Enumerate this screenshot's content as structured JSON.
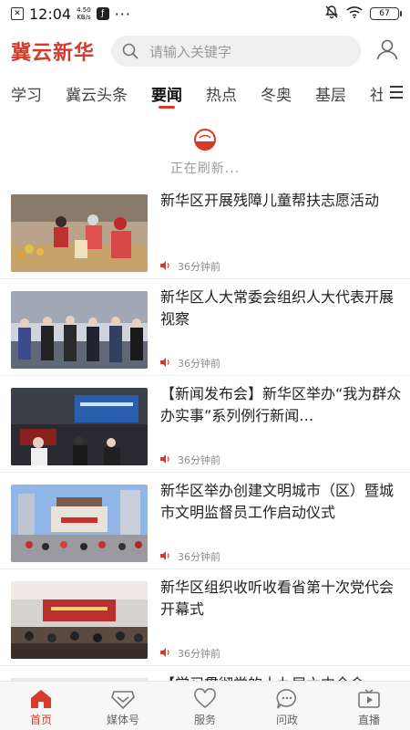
{
  "status_bar": {
    "time": "12:04",
    "speed_value": "4.50",
    "speed_unit": "KB/s",
    "more": "···",
    "battery": "67"
  },
  "header": {
    "logo": "冀云新华",
    "search_placeholder": "请输入关键字"
  },
  "tabs": [
    {
      "label": "学习",
      "active": false
    },
    {
      "label": "冀云头条",
      "active": false
    },
    {
      "label": "要闻",
      "active": true
    },
    {
      "label": "热点",
      "active": false
    },
    {
      "label": "冬奥",
      "active": false
    },
    {
      "label": "基层",
      "active": false
    },
    {
      "label": "社",
      "active": false
    }
  ],
  "refresh": {
    "text": "正在刷新..."
  },
  "news": [
    {
      "title": "新华区开展残障儿童帮扶志愿活动",
      "time": "36分钟前"
    },
    {
      "title": "新华区人大常委会组织人大代表开展视察",
      "time": "36分钟前"
    },
    {
      "title": "【新闻发布会】新华区举办“我为群众办实事”系列例行新闻…",
      "time": "36分钟前"
    },
    {
      "title": "新华区举办创建文明城市（区）暨城市文明监督员工作启动仪式",
      "time": "36分钟前"
    },
    {
      "title": "新华区组织收听收看省第十次党代会开幕式",
      "time": "36分钟前"
    },
    {
      "title": "【学习贯彻党的十九届六中全会…",
      "time": ""
    }
  ],
  "bottom_nav": [
    {
      "label": "首页",
      "active": true
    },
    {
      "label": "媒体号",
      "active": false
    },
    {
      "label": "服务",
      "active": false
    },
    {
      "label": "问政",
      "active": false
    },
    {
      "label": "直播",
      "active": false
    }
  ],
  "colors": {
    "brand": "#d63a2a",
    "text": "#222222",
    "muted": "#8a8a8a"
  }
}
